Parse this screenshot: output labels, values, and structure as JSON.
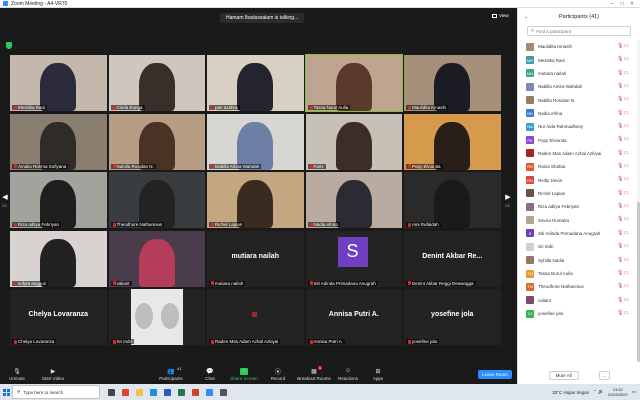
{
  "window": {
    "title": "Zoom Meeting - A4-VR70",
    "controls": [
      "–",
      "□",
      "×"
    ]
  },
  "meeting": {
    "talking_indicator": "Hamam Ibadussalam is talking...",
    "view_label": "View",
    "left_arrow": "◀",
    "right_arrow": "▶",
    "page_left": "2/2",
    "page_right": "2/2",
    "tiles": [
      {
        "name": "Mesitika Rani",
        "kind": "video",
        "bg": "#c4b8ad",
        "fg": "#2a2a3a"
      },
      {
        "name": "Cinda Eunga",
        "kind": "video",
        "bg": "#cfc6bd",
        "fg": "#3a2e2b"
      },
      {
        "name": "pan azahra",
        "kind": "video",
        "bg": "#d9cfc2",
        "fg": "#242430"
      },
      {
        "name": "Tassa Nurul Aulia",
        "kind": "video",
        "bg": "#bda591",
        "fg": "#5a3a2a",
        "speaking": true
      },
      {
        "name": "Maulidita Kinasih",
        "kind": "video",
        "bg": "#a5907a",
        "fg": "#1c1c24"
      },
      {
        "name": "Amalia Rahma Sofiyana",
        "kind": "video",
        "bg": "#8a7e70",
        "fg": "#2e2b28"
      },
      {
        "name": "Nabilla Rosidan N.",
        "kind": "video",
        "bg": "#b79d84",
        "fg": "#4a3325"
      },
      {
        "name": "Nabilla Amira Wahdah",
        "kind": "video",
        "bg": "#d8d6d2",
        "fg": "#6e7fa6"
      },
      {
        "name": "Faris",
        "kind": "video",
        "bg": "#c7c0b4",
        "fg": "#3b2e26"
      },
      {
        "name": "Popy Elvionita",
        "kind": "video",
        "bg": "#d59a4c",
        "fg": "#2a1e18"
      },
      {
        "name": "Riza aditya Febriyan",
        "kind": "video",
        "bg": "#a3a39d",
        "fg": "#1e1e1e"
      },
      {
        "name": "Theodhore Nathannius",
        "kind": "video",
        "bg": "#3a3d3f",
        "fg": "#232324"
      },
      {
        "name": "Richel Lapian",
        "kind": "video",
        "bg": "#c2a780",
        "fg": "#3a2b20"
      },
      {
        "name": "Nadia efrina",
        "kind": "video",
        "bg": "#b9aba0",
        "fg": "#2b2b33"
      },
      {
        "name": "Aini Rufaidah",
        "kind": "video",
        "bg": "#2b2a2a",
        "fg": "#1a1a1a"
      },
      {
        "name": "sofyta anggun",
        "kind": "video",
        "bg": "#d8d3d0",
        "fg": "#222"
      },
      {
        "name": "valiant",
        "kind": "video",
        "bg": "#4a3c4a",
        "fg": "#b43d59"
      },
      {
        "name": "mutiara nailah",
        "kind": "name",
        "display": "mutiara nailah"
      },
      {
        "name": "Siti Adinda Primadana Anugrah",
        "kind": "avatar",
        "letter": "S"
      },
      {
        "name": "Denint Akbar Reggi Dewangga",
        "kind": "name",
        "display": "Denint Akbar Re..."
      },
      {
        "name": "Chelya Lovaranza",
        "kind": "name",
        "display": "Chelya Lovaranza"
      },
      {
        "name": "Sri Indri",
        "kind": "angel"
      },
      {
        "name": "Raden Mas Adam Azhal Azkiyai",
        "kind": "red"
      },
      {
        "name": "Annisa Putri A.",
        "kind": "name",
        "display": "Annisa Putri A."
      },
      {
        "name": "yosefine jola",
        "kind": "name",
        "display": "yosefine jola"
      }
    ]
  },
  "toolbar": {
    "unmute": "Unmute",
    "start_video": "Start Video",
    "participants": "Participants",
    "participants_count": "41",
    "chat": "Chat",
    "share_screen": "Share Screen",
    "record": "Record",
    "breakout_rooms": "Breakout Rooms",
    "breakout_badge": "1",
    "reactions": "Reactions",
    "apps": "Apps",
    "leave": "Leave Room"
  },
  "panel": {
    "title": "Participants (41)",
    "search_placeholder": "Find a participant",
    "mute_all": "Mute All",
    "more": "...",
    "participants": [
      {
        "name": "Maulidita Kinasih",
        "initials": "",
        "color": "#a58a73"
      },
      {
        "name": "Mesitika Rani",
        "initials": "MR",
        "color": "#3aa0a4"
      },
      {
        "name": "mutiara nailah",
        "initials": "MN",
        "color": "#39a87a"
      },
      {
        "name": "Nabilla Amira Wahdah",
        "initials": "",
        "color": "#7b8ab0"
      },
      {
        "name": "Nabilla Rosidan N.",
        "initials": "",
        "color": "#9a7c66"
      },
      {
        "name": "Nadia efrina",
        "initials": "NE",
        "color": "#3a7cd8"
      },
      {
        "name": "Nur Aida Rahmadhany",
        "initials": "NA",
        "color": "#3aa0c8"
      },
      {
        "name": "Popy Elvionita",
        "initials": "PE",
        "color": "#8e44d6"
      },
      {
        "name": "Raden Mas Adam Azhal Azkiyai",
        "initials": "",
        "color": "#a32525"
      },
      {
        "name": "Rania Shafaa",
        "initials": "RS",
        "color": "#e05a2b"
      },
      {
        "name": "Reilty Devia",
        "initials": "RD",
        "color": "#d9493a"
      },
      {
        "name": "Richel Lapian",
        "initials": "",
        "color": "#6b5547"
      },
      {
        "name": "Riza aditya Febriyan",
        "initials": "",
        "color": "#8c6b8e"
      },
      {
        "name": "Savira Humaira",
        "initials": "",
        "color": "#b8a38f"
      },
      {
        "name": "Siti Adinda Primadana Anugrah",
        "initials": "S",
        "color": "#6f3fc2"
      },
      {
        "name": "Sri Indri",
        "initials": "",
        "color": "#d0d0d0"
      },
      {
        "name": "Syhilla Nadia",
        "initials": "",
        "color": "#8f7b6a"
      },
      {
        "name": "Tassa Nurul Aulia",
        "initials": "TN",
        "color": "#e79a2a"
      },
      {
        "name": "Theodhore Nathannius",
        "initials": "TN",
        "color": "#e0692b"
      },
      {
        "name": "valiant",
        "initials": "",
        "color": "#7a4c63"
      },
      {
        "name": "yosefine jola",
        "initials": "YJ",
        "color": "#3fb05a"
      }
    ]
  },
  "taskbar": {
    "search_placeholder": "Type here to search",
    "weather": "33°C  Hujan ringan",
    "time": "13:32",
    "date": "21/03/2022",
    "apps": [
      {
        "name": "task-view",
        "color": "#444"
      },
      {
        "name": "chrome",
        "color": "#e34133"
      },
      {
        "name": "file-explorer",
        "color": "#f2c14e"
      },
      {
        "name": "edge",
        "color": "#1e8fd6"
      },
      {
        "name": "word",
        "color": "#2b5bb5"
      },
      {
        "name": "excel",
        "color": "#1d7a46"
      },
      {
        "name": "powerpoint",
        "color": "#c9472b"
      },
      {
        "name": "zoom",
        "color": "#2d8cff"
      },
      {
        "name": "store",
        "color": "#555"
      }
    ]
  }
}
